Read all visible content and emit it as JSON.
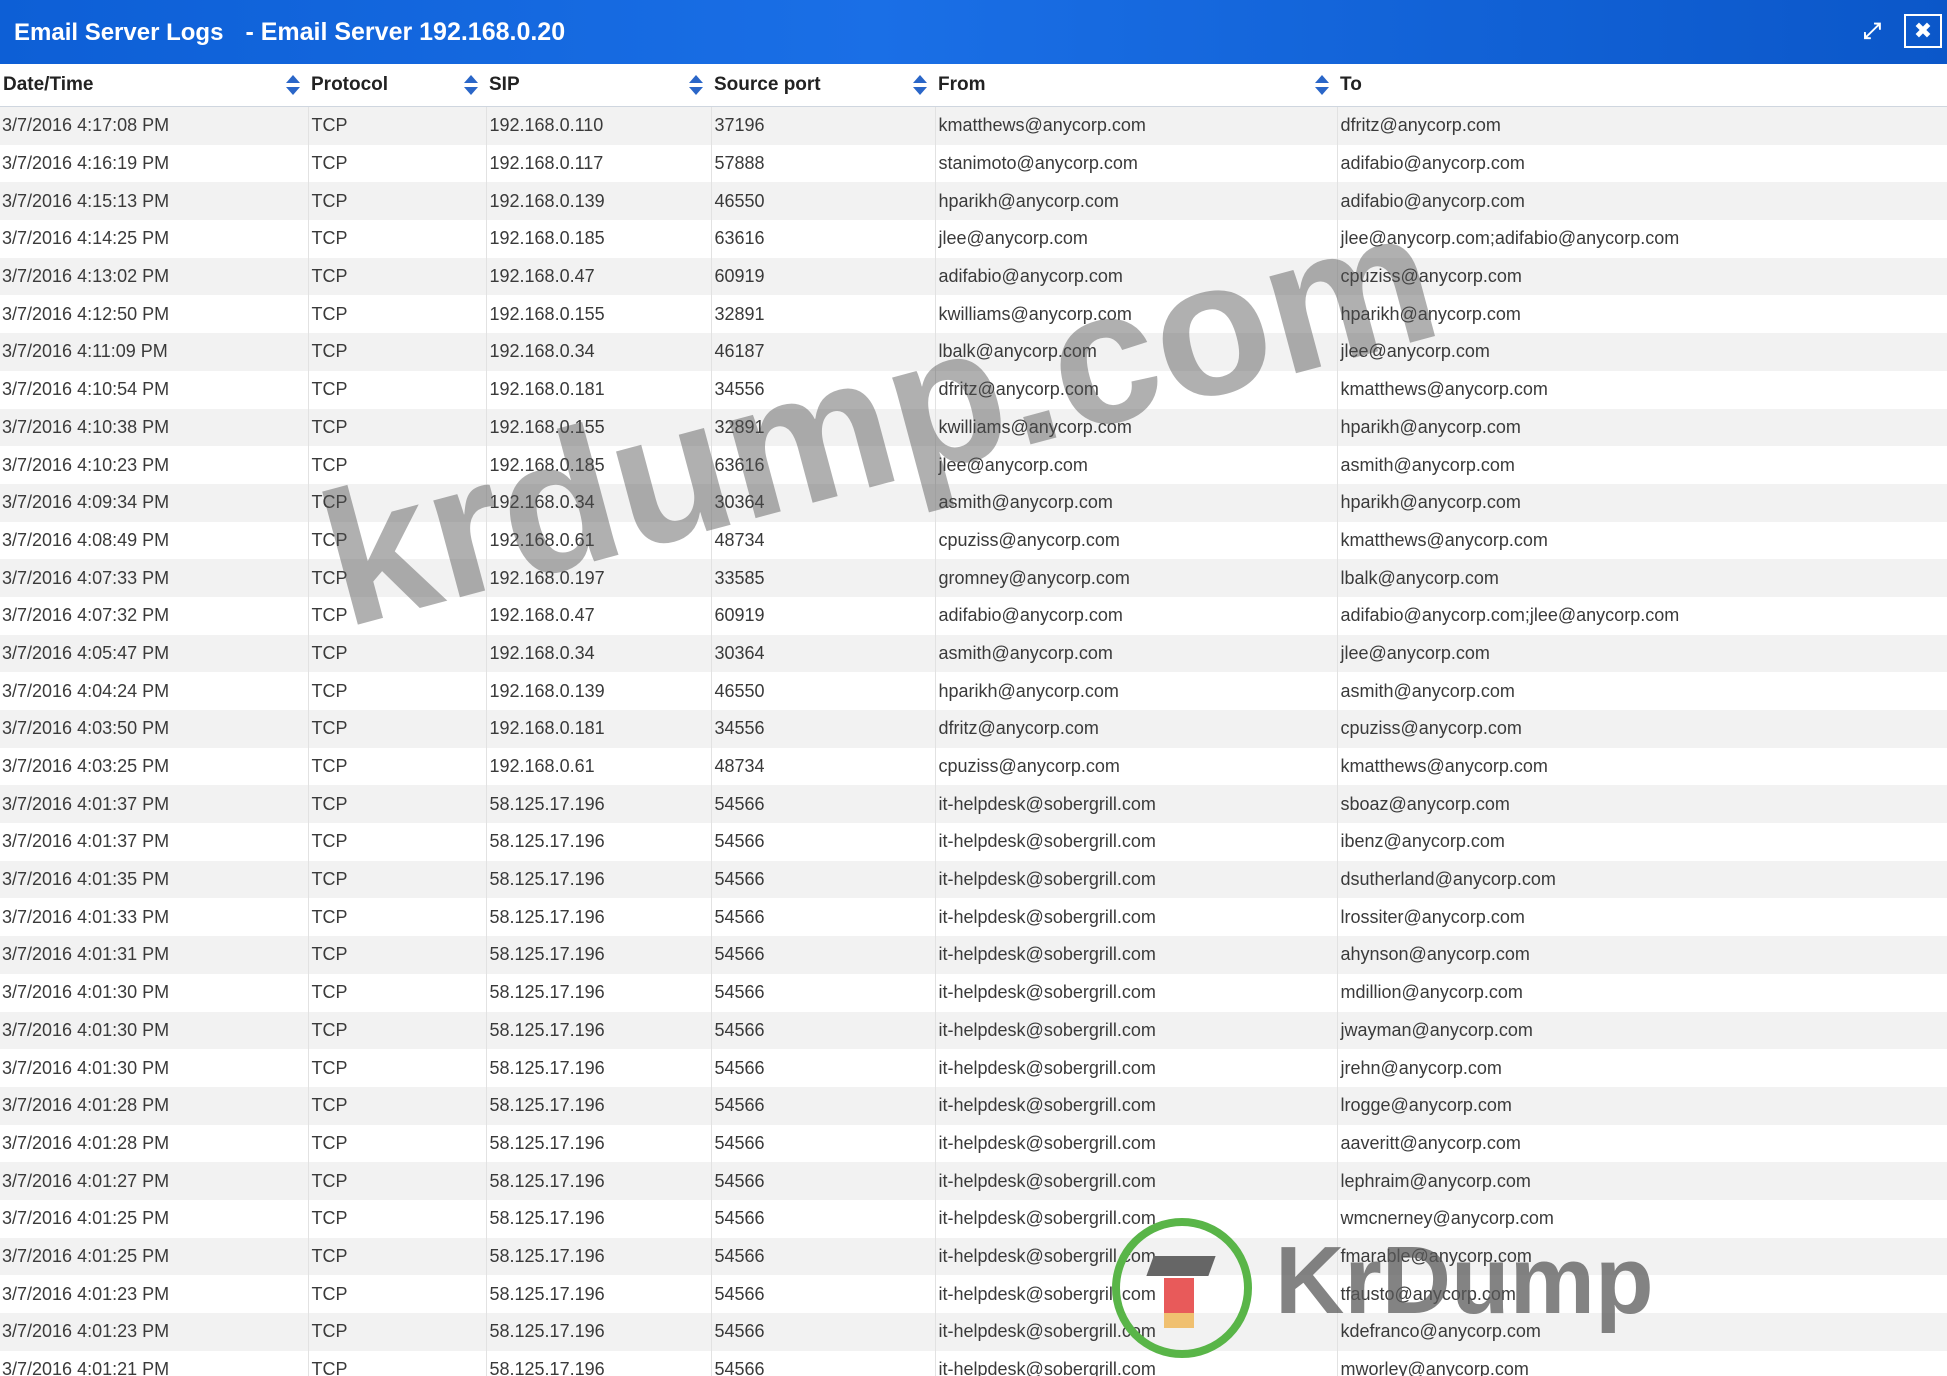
{
  "window": {
    "title": "Email Server Logs",
    "subtitle": "- Email Server 192.168.0.20",
    "restore_icon": "shrink-arrows-icon",
    "close_icon": "close-x-icon",
    "accent_color": "#1565d8"
  },
  "table": {
    "columns": [
      "Date/Time",
      "Protocol",
      "SIP",
      "Source port",
      "From",
      "To"
    ],
    "rows": [
      [
        "3/7/2016 4:17:08 PM",
        "TCP",
        "192.168.0.110",
        "37196",
        "kmatthews@anycorp.com",
        "dfritz@anycorp.com"
      ],
      [
        "3/7/2016 4:16:19 PM",
        "TCP",
        "192.168.0.117",
        "57888",
        "stanimoto@anycorp.com",
        "adifabio@anycorp.com"
      ],
      [
        "3/7/2016 4:15:13 PM",
        "TCP",
        "192.168.0.139",
        "46550",
        "hparikh@anycorp.com",
        "adifabio@anycorp.com"
      ],
      [
        "3/7/2016 4:14:25 PM",
        "TCP",
        "192.168.0.185",
        "63616",
        "jlee@anycorp.com",
        "jlee@anycorp.com;adifabio@anycorp.com"
      ],
      [
        "3/7/2016 4:13:02 PM",
        "TCP",
        "192.168.0.47",
        "60919",
        "adifabio@anycorp.com",
        "cpuziss@anycorp.com"
      ],
      [
        "3/7/2016 4:12:50 PM",
        "TCP",
        "192.168.0.155",
        "32891",
        "kwilliams@anycorp.com",
        "hparikh@anycorp.com"
      ],
      [
        "3/7/2016 4:11:09 PM",
        "TCP",
        "192.168.0.34",
        "46187",
        "lbalk@anycorp.com",
        "jlee@anycorp.com"
      ],
      [
        "3/7/2016 4:10:54 PM",
        "TCP",
        "192.168.0.181",
        "34556",
        "dfritz@anycorp.com",
        "kmatthews@anycorp.com"
      ],
      [
        "3/7/2016 4:10:38 PM",
        "TCP",
        "192.168.0.155",
        "32891",
        "kwilliams@anycorp.com",
        "hparikh@anycorp.com"
      ],
      [
        "3/7/2016 4:10:23 PM",
        "TCP",
        "192.168.0.185",
        "63616",
        "jlee@anycorp.com",
        "asmith@anycorp.com"
      ],
      [
        "3/7/2016 4:09:34 PM",
        "TCP",
        "192.168.0.34",
        "30364",
        "asmith@anycorp.com",
        "hparikh@anycorp.com"
      ],
      [
        "3/7/2016 4:08:49 PM",
        "TCP",
        "192.168.0.61",
        "48734",
        "cpuziss@anycorp.com",
        "kmatthews@anycorp.com"
      ],
      [
        "3/7/2016 4:07:33 PM",
        "TCP",
        "192.168.0.197",
        "33585",
        "gromney@anycorp.com",
        "lbalk@anycorp.com"
      ],
      [
        "3/7/2016 4:07:32 PM",
        "TCP",
        "192.168.0.47",
        "60919",
        "adifabio@anycorp.com",
        "adifabio@anycorp.com;jlee@anycorp.com"
      ],
      [
        "3/7/2016 4:05:47 PM",
        "TCP",
        "192.168.0.34",
        "30364",
        "asmith@anycorp.com",
        "jlee@anycorp.com"
      ],
      [
        "3/7/2016 4:04:24 PM",
        "TCP",
        "192.168.0.139",
        "46550",
        "hparikh@anycorp.com",
        "asmith@anycorp.com"
      ],
      [
        "3/7/2016 4:03:50 PM",
        "TCP",
        "192.168.0.181",
        "34556",
        "dfritz@anycorp.com",
        "cpuziss@anycorp.com"
      ],
      [
        "3/7/2016 4:03:25 PM",
        "TCP",
        "192.168.0.61",
        "48734",
        "cpuziss@anycorp.com",
        "kmatthews@anycorp.com"
      ],
      [
        "3/7/2016 4:01:37 PM",
        "TCP",
        "58.125.17.196",
        "54566",
        "it-helpdesk@sobergrill.com",
        "sboaz@anycorp.com"
      ],
      [
        "3/7/2016 4:01:37 PM",
        "TCP",
        "58.125.17.196",
        "54566",
        "it-helpdesk@sobergrill.com",
        "ibenz@anycorp.com"
      ],
      [
        "3/7/2016 4:01:35 PM",
        "TCP",
        "58.125.17.196",
        "54566",
        "it-helpdesk@sobergrill.com",
        "dsutherland@anycorp.com"
      ],
      [
        "3/7/2016 4:01:33 PM",
        "TCP",
        "58.125.17.196",
        "54566",
        "it-helpdesk@sobergrill.com",
        "lrossiter@anycorp.com"
      ],
      [
        "3/7/2016 4:01:31 PM",
        "TCP",
        "58.125.17.196",
        "54566",
        "it-helpdesk@sobergrill.com",
        "ahynson@anycorp.com"
      ],
      [
        "3/7/2016 4:01:30 PM",
        "TCP",
        "58.125.17.196",
        "54566",
        "it-helpdesk@sobergrill.com",
        "mdillion@anycorp.com"
      ],
      [
        "3/7/2016 4:01:30 PM",
        "TCP",
        "58.125.17.196",
        "54566",
        "it-helpdesk@sobergrill.com",
        "jwayman@anycorp.com"
      ],
      [
        "3/7/2016 4:01:30 PM",
        "TCP",
        "58.125.17.196",
        "54566",
        "it-helpdesk@sobergrill.com",
        "jrehn@anycorp.com"
      ],
      [
        "3/7/2016 4:01:28 PM",
        "TCP",
        "58.125.17.196",
        "54566",
        "it-helpdesk@sobergrill.com",
        "lrogge@anycorp.com"
      ],
      [
        "3/7/2016 4:01:28 PM",
        "TCP",
        "58.125.17.196",
        "54566",
        "it-helpdesk@sobergrill.com",
        "aaveritt@anycorp.com"
      ],
      [
        "3/7/2016 4:01:27 PM",
        "TCP",
        "58.125.17.196",
        "54566",
        "it-helpdesk@sobergrill.com",
        "lephraim@anycorp.com"
      ],
      [
        "3/7/2016 4:01:25 PM",
        "TCP",
        "58.125.17.196",
        "54566",
        "it-helpdesk@sobergrill.com",
        "wmcnerney@anycorp.com"
      ],
      [
        "3/7/2016 4:01:25 PM",
        "TCP",
        "58.125.17.196",
        "54566",
        "it-helpdesk@sobergrill.com",
        "fmarable@anycorp.com"
      ],
      [
        "3/7/2016 4:01:23 PM",
        "TCP",
        "58.125.17.196",
        "54566",
        "it-helpdesk@sobergrill.com",
        "tfausto@anycorp.com"
      ],
      [
        "3/7/2016 4:01:23 PM",
        "TCP",
        "58.125.17.196",
        "54566",
        "it-helpdesk@sobergrill.com",
        "kdefranco@anycorp.com"
      ],
      [
        "3/7/2016 4:01:21 PM",
        "TCP",
        "58.125.17.196",
        "54566",
        "it-helpdesk@sobergrill.com",
        "mworley@anycorp.com"
      ]
    ]
  },
  "watermark": {
    "text": "krdump.com",
    "logo_text": "KrDump"
  }
}
